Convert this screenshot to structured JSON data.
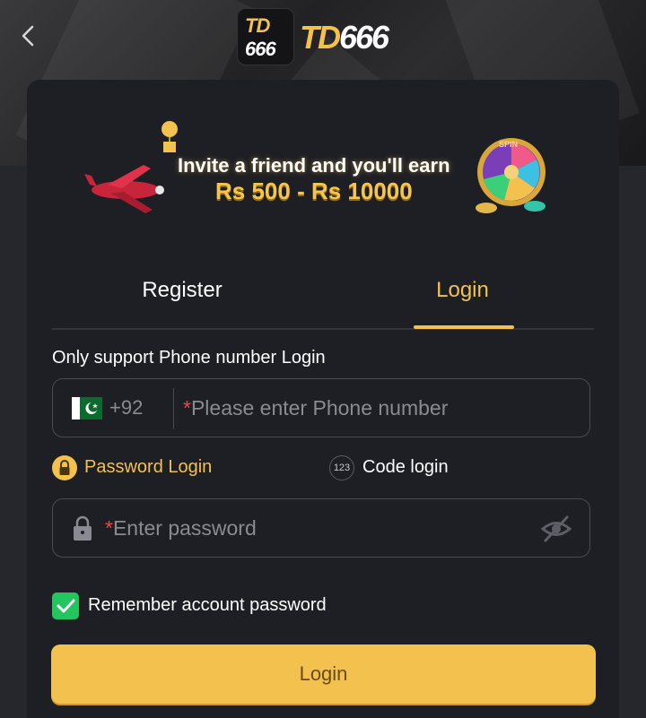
{
  "header": {
    "logo_text_prefix": "TD",
    "logo_text_number": "666"
  },
  "banner": {
    "line1": "Invite a friend and you'll earn",
    "line2": "Rs 500 - Rs 10000",
    "wheel_label": "SPIN"
  },
  "tabs": [
    {
      "label": "Register",
      "active": false
    },
    {
      "label": "Login",
      "active": true
    }
  ],
  "form": {
    "hint": "Only support Phone number Login",
    "phone": {
      "country_code": "+92",
      "required_mark": "*",
      "placeholder": "Please enter Phone number"
    },
    "login_modes": {
      "password_label": "Password Login",
      "code_label": "Code login",
      "code_icon_text": "123"
    },
    "password": {
      "required_mark": "*",
      "placeholder": "Enter password"
    },
    "remember": {
      "label": "Remember account password",
      "checked": true
    },
    "submit_label": "Login"
  },
  "colors": {
    "accent": "#f2c14e",
    "checkbox": "#22c55e",
    "required": "#e24a4a"
  }
}
